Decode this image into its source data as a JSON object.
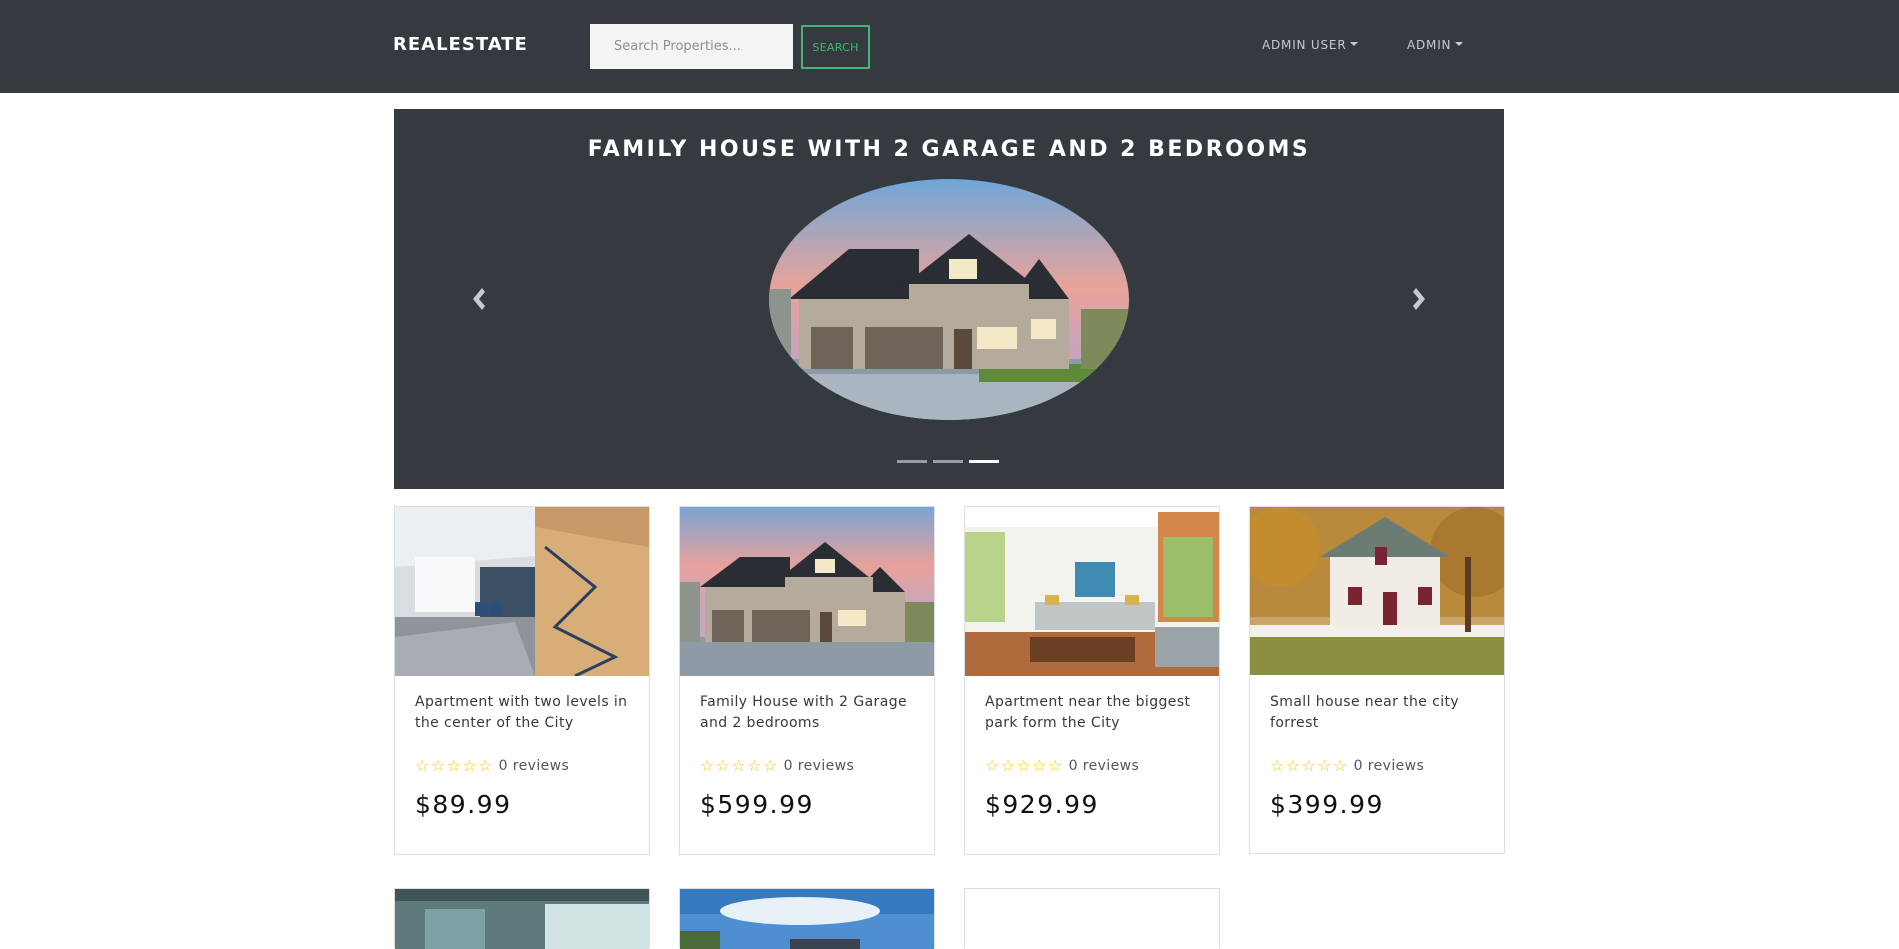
{
  "navbar": {
    "brand": "REALESTATE",
    "search_placeholder": "Search Properties...",
    "search_button": "SEARCH",
    "menu_user": "ADMIN USER",
    "menu_admin": "ADMIN"
  },
  "carousel": {
    "title": "FAMILY HOUSE WITH 2 GARAGE AND 2 BEDROOMS",
    "slide_count": 3,
    "active_slide": 3,
    "prev_icon": "chevron-left-icon",
    "next_icon": "chevron-right-icon"
  },
  "products": [
    {
      "title": "Apartment with two levels in the center of the City",
      "rating": 0,
      "reviews": "0 reviews",
      "price": "$89.99"
    },
    {
      "title": "Family House with 2 Garage and 2 bedrooms",
      "rating": 0,
      "reviews": "0 reviews",
      "price": "$599.99"
    },
    {
      "title": "Apartment near the biggest park form the City",
      "rating": 0,
      "reviews": "0 reviews",
      "price": "$929.99"
    },
    {
      "title": "Small house near the city forrest",
      "rating": 0,
      "reviews": "0 reviews",
      "price": "$399.99"
    }
  ],
  "colors": {
    "navbar_bg": "#343a40",
    "accent_green": "#3fb771",
    "star_yellow": "#f0c419"
  }
}
